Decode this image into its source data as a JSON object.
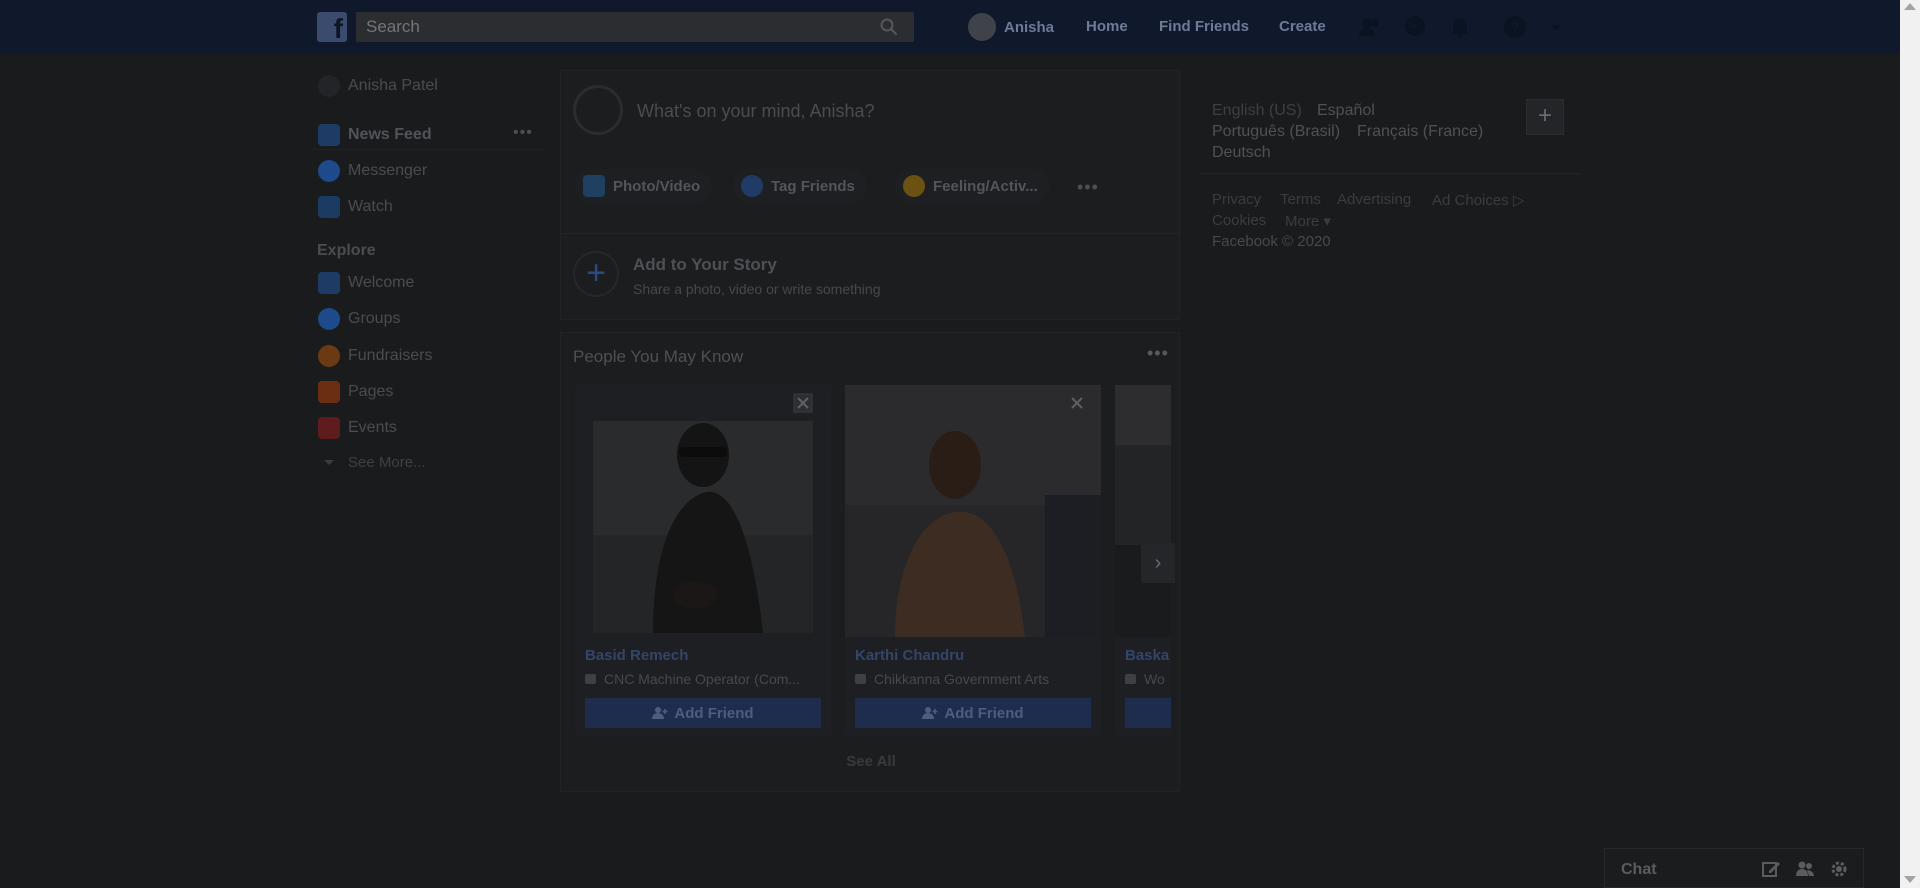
{
  "topbar": {
    "search_placeholder": "Search",
    "profile_name": "Anisha",
    "home": "Home",
    "find_friends": "Find Friends",
    "create": "Create"
  },
  "sidebar": {
    "profile": "Anisha Patel",
    "items": [
      {
        "label": "News Feed"
      },
      {
        "label": "Messenger"
      },
      {
        "label": "Watch"
      }
    ],
    "explore_heading": "Explore",
    "explore": [
      {
        "label": "Welcome"
      },
      {
        "label": "Groups"
      },
      {
        "label": "Fundraisers"
      },
      {
        "label": "Pages"
      },
      {
        "label": "Events"
      },
      {
        "label": "See More..."
      }
    ]
  },
  "composer": {
    "placeholder": "What's on your mind, Anisha?",
    "photo_video": "Photo/Video",
    "tag_friends": "Tag Friends",
    "feeling": "Feeling/Activ...",
    "story_title": "Add to Your Story",
    "story_sub": "Share a photo, video or write something"
  },
  "pymk": {
    "title": "People You May Know",
    "see_all": "See All",
    "people": [
      {
        "name": "Basid Remech",
        "work": "CNC Machine Operator (Com...",
        "button": "Add Friend"
      },
      {
        "name": "Karthi Chandru",
        "work": "Chikkanna Government Arts",
        "button": "Add Friend"
      },
      {
        "name": "Baska",
        "work": "Wo",
        "button": ""
      }
    ]
  },
  "right": {
    "languages": {
      "current": "English (US)",
      "espanol": "Español",
      "portugues": "Português (Brasil)",
      "francais": "Français (France)",
      "deutsch": "Deutsch"
    },
    "footer": {
      "privacy": "Privacy",
      "terms": "Terms",
      "advertising": "Advertising",
      "adchoices": "Ad Choices",
      "cookies": "Cookies",
      "more": "More",
      "copyright": "Facebook © 2020"
    }
  },
  "chat": {
    "label": "Chat"
  },
  "colors": {
    "overlay_bg": "#1a1b1d",
    "topbar": "#10192b",
    "brand_dim": "#1e2d4e"
  }
}
